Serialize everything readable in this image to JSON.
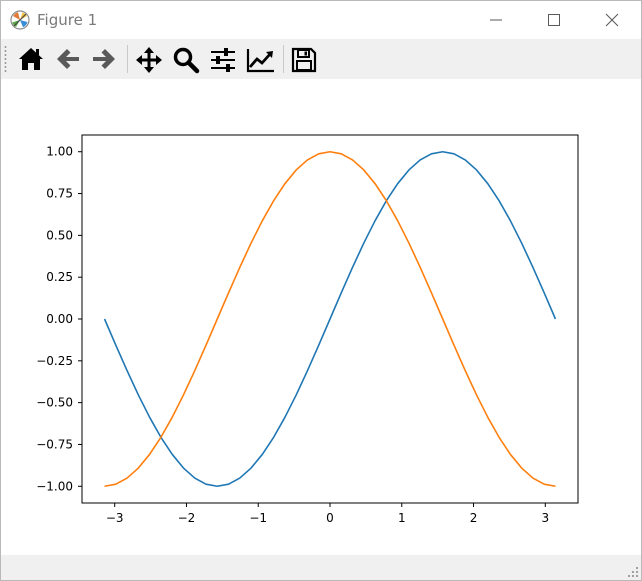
{
  "window": {
    "title": "Figure 1",
    "minimize_icon": "minimize-icon",
    "maximize_icon": "maximize-icon",
    "close_icon": "close-icon"
  },
  "toolbar": {
    "tools": [
      {
        "name": "home",
        "icon": "home-icon"
      },
      {
        "name": "back",
        "icon": "arrow-left-icon"
      },
      {
        "name": "forward",
        "icon": "arrow-right-icon"
      },
      {
        "name": "pan",
        "icon": "move-icon"
      },
      {
        "name": "zoom",
        "icon": "magnifier-icon"
      },
      {
        "name": "configure-subplots",
        "icon": "sliders-icon"
      },
      {
        "name": "edit-axis",
        "icon": "line-chart-icon"
      },
      {
        "name": "save",
        "icon": "floppy-disk-icon"
      }
    ]
  },
  "statusbar": {
    "text": ""
  },
  "chart_data": {
    "type": "line",
    "title": "",
    "xlabel": "",
    "ylabel": "",
    "xlim": [
      -3.4558,
      3.4558
    ],
    "ylim": [
      -1.1,
      1.1
    ],
    "xticks": [
      -3,
      -2,
      -1,
      0,
      1,
      2,
      3
    ],
    "xtick_labels": [
      "−3",
      "−2",
      "−1",
      "0",
      "1",
      "2",
      "3"
    ],
    "yticks": [
      -1.0,
      -0.75,
      -0.5,
      -0.25,
      0.0,
      0.25,
      0.5,
      0.75,
      1.0
    ],
    "ytick_labels": [
      "−1.00",
      "−0.75",
      "−0.50",
      "−0.25",
      "0.00",
      "0.25",
      "0.50",
      "0.75",
      "1.00"
    ],
    "grid": false,
    "legend": "none",
    "series": [
      {
        "color": "#1f77b4",
        "x": [
          -3.1416,
          -2.9845,
          -2.8274,
          -2.6704,
          -2.5133,
          -2.3562,
          -2.1991,
          -2.042,
          -1.885,
          -1.7279,
          -1.5708,
          -1.4137,
          -1.2566,
          -1.0996,
          -0.9425,
          -0.7854,
          -0.6283,
          -0.4712,
          -0.3142,
          -0.1571,
          0.0,
          0.1571,
          0.3142,
          0.4712,
          0.6283,
          0.7854,
          0.9425,
          1.0996,
          1.2566,
          1.4137,
          1.5708,
          1.7279,
          1.885,
          2.042,
          2.1991,
          2.3562,
          2.5133,
          2.6704,
          2.8274,
          2.9845,
          3.1416
        ],
        "y": [
          0.0,
          -0.1564,
          -0.309,
          -0.454,
          -0.5878,
          -0.7071,
          -0.809,
          -0.891,
          -0.9511,
          -0.9877,
          -1.0,
          -0.9877,
          -0.9511,
          -0.891,
          -0.809,
          -0.7071,
          -0.5878,
          -0.454,
          -0.309,
          -0.1564,
          0.0,
          0.1564,
          0.309,
          0.454,
          0.5878,
          0.7071,
          0.809,
          0.891,
          0.9511,
          0.9877,
          1.0,
          0.9877,
          0.9511,
          0.891,
          0.809,
          0.7071,
          0.5878,
          0.454,
          0.309,
          0.1564,
          0.0
        ]
      },
      {
        "color": "#ff7f0e",
        "x": [
          -3.1416,
          -2.9845,
          -2.8274,
          -2.6704,
          -2.5133,
          -2.3562,
          -2.1991,
          -2.042,
          -1.885,
          -1.7279,
          -1.5708,
          -1.4137,
          -1.2566,
          -1.0996,
          -0.9425,
          -0.7854,
          -0.6283,
          -0.4712,
          -0.3142,
          -0.1571,
          0.0,
          0.1571,
          0.3142,
          0.4712,
          0.6283,
          0.7854,
          0.9425,
          1.0996,
          1.2566,
          1.4137,
          1.5708,
          1.7279,
          1.885,
          2.042,
          2.1991,
          2.3562,
          2.5133,
          2.6704,
          2.8274,
          2.9845,
          3.1416
        ],
        "y": [
          -1.0,
          -0.9877,
          -0.9511,
          -0.891,
          -0.809,
          -0.7071,
          -0.5878,
          -0.454,
          -0.309,
          -0.1564,
          0.0,
          0.1564,
          0.309,
          0.454,
          0.5878,
          0.7071,
          0.809,
          0.891,
          0.9511,
          0.9877,
          1.0,
          0.9877,
          0.9511,
          0.891,
          0.809,
          0.7071,
          0.5878,
          0.454,
          0.309,
          0.1564,
          0.0,
          -0.1564,
          -0.309,
          -0.454,
          -0.5878,
          -0.7071,
          -0.809,
          -0.891,
          -0.9511,
          -0.9877,
          -1.0
        ]
      }
    ]
  }
}
